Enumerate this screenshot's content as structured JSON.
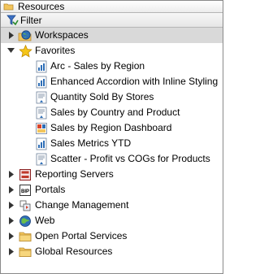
{
  "panel": {
    "title": "Resources",
    "title_icon": "folder-breadcrumb-icon"
  },
  "filter": {
    "label": "Filter",
    "icon": "filter-funnel-icon"
  },
  "tree": {
    "workspaces": {
      "label": "Workspaces",
      "icon": "globe-folder-icon",
      "expanded": false,
      "selected": true
    },
    "favorites": {
      "label": "Favorites",
      "icon": "star-icon",
      "expanded": true,
      "items": [
        {
          "label": "Arc - Sales by Region",
          "icon": "report-chart-icon"
        },
        {
          "label": "Enhanced Accordion with Inline Styling",
          "icon": "report-chart-icon"
        },
        {
          "label": "Quantity Sold By Stores",
          "icon": "report-document-icon"
        },
        {
          "label": "Sales by Country and Product",
          "icon": "report-document-icon"
        },
        {
          "label": "Sales by Region Dashboard",
          "icon": "dashboard-icon"
        },
        {
          "label": "Sales Metrics YTD",
          "icon": "report-chart-icon"
        },
        {
          "label": "Scatter - Profit vs COGs for Products",
          "icon": "report-document-icon"
        }
      ]
    },
    "reporting_servers": {
      "label": "Reporting Servers",
      "icon": "server-icon",
      "expanded": false
    },
    "portals": {
      "label": "Portals",
      "icon": "bip-portal-icon",
      "badge": "BIP",
      "expanded": false
    },
    "change_management": {
      "label": "Change Management",
      "icon": "change-management-icon",
      "expanded": false
    },
    "web": {
      "label": "Web",
      "icon": "web-globe-icon",
      "expanded": false
    },
    "open_portal_services": {
      "label": "Open Portal Services",
      "icon": "folder-icon",
      "expanded": false
    },
    "global_resources": {
      "label": "Global Resources",
      "icon": "folder-icon",
      "expanded": false
    }
  },
  "colors": {
    "selected_row": "#d9d9d9",
    "folder_yellow": "#f2c55c",
    "star_yellow": "#f5c518",
    "globe_blue": "#2f6fb7"
  }
}
